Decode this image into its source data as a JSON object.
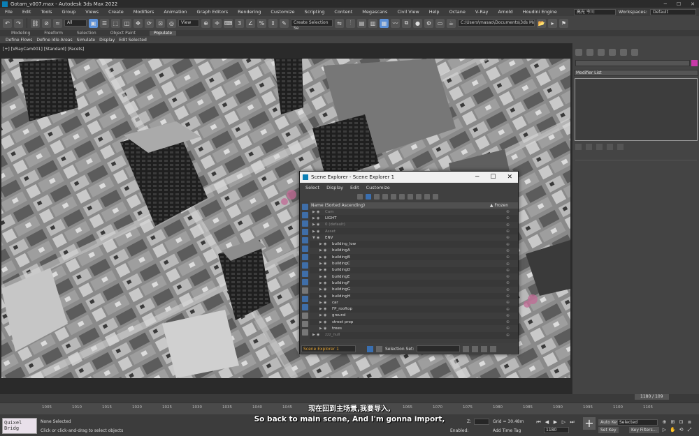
{
  "window": {
    "title": "Gotam_v007.max - Autodesk 3ds Max 2022"
  },
  "menu": [
    "File",
    "Edit",
    "Tools",
    "Group",
    "Views",
    "Create",
    "Modifiers",
    "Animation",
    "Graph Editors",
    "Rendering",
    "Customize",
    "Scripting",
    "Content",
    "Megascans",
    "Civil View",
    "Help",
    "Octane",
    "V-Ray",
    "Arnold",
    "Houdini Engine"
  ],
  "user": {
    "name": "高光 今川",
    "workspaces_label": "Workspaces:",
    "workspace": "Default"
  },
  "toolbar": {
    "filter": "All",
    "view": "View",
    "selection_set": "Create Selection Se",
    "path": "C:\\Users\\masao\\Documents\\3ds Max 2022"
  },
  "ribbon": {
    "tabs": [
      "Modeling",
      "Freeform",
      "Selection",
      "Object Paint",
      "Populate"
    ],
    "active": "Populate",
    "items": [
      "Define Flows",
      "Define Idle Areas",
      "Simulate",
      "Display",
      "Edit Selected"
    ]
  },
  "viewport": {
    "label": "[+] [VRayCam001] [Standard] [Facets]"
  },
  "command_panel": {
    "modifier_list": "Modifier List",
    "accent": "#c83aa8"
  },
  "scene_explorer": {
    "title": "Scene Explorer - Scene Explorer 1",
    "menu": [
      "Select",
      "Display",
      "Edit",
      "Customize"
    ],
    "col_name": "Name (Sorted Ascending)",
    "col_frozen": "▲ Frozen",
    "rows": [
      {
        "label": "Cam",
        "indent": 0,
        "dim": true
      },
      {
        "label": "LIGHT",
        "indent": 0,
        "dim": false
      },
      {
        "label": "0 (default)",
        "indent": 0,
        "dim": true
      },
      {
        "label": "Asset",
        "indent": 0,
        "dim": true
      },
      {
        "label": "ENV",
        "indent": 0,
        "dim": false
      },
      {
        "label": "building_low",
        "indent": 1,
        "dim": false
      },
      {
        "label": "buildingA",
        "indent": 1,
        "dim": false
      },
      {
        "label": "buildingB",
        "indent": 1,
        "dim": false
      },
      {
        "label": "buildingC",
        "indent": 1,
        "dim": false
      },
      {
        "label": "buildingD",
        "indent": 1,
        "dim": false
      },
      {
        "label": "buildingE",
        "indent": 1,
        "dim": false
      },
      {
        "label": "buildingF",
        "indent": 1,
        "dim": false
      },
      {
        "label": "buildingG",
        "indent": 1,
        "dim": false
      },
      {
        "label": "buildingH",
        "indent": 1,
        "dim": false
      },
      {
        "label": "car",
        "indent": 1,
        "dim": false
      },
      {
        "label": "FP_rooftop",
        "indent": 1,
        "dim": false
      },
      {
        "label": "ground",
        "indent": 1,
        "dim": false
      },
      {
        "label": "street prop",
        "indent": 1,
        "dim": false
      },
      {
        "label": "trees",
        "indent": 1,
        "dim": false
      },
      {
        "label": "zzz_null",
        "indent": 0,
        "dim": true
      }
    ],
    "footer_explorer": "Scene Explorer 1",
    "footer_selset": "Selection Set:"
  },
  "timeline": {
    "frame": "1180 / 109",
    "ticks": [
      "1005",
      "1010",
      "1015",
      "1020",
      "1025",
      "1030",
      "1035",
      "1040",
      "1045",
      "1050",
      "1055",
      "1060",
      "1065",
      "1070",
      "1075",
      "1080",
      "1085",
      "1090",
      "1095",
      "1100",
      "1105"
    ]
  },
  "status": {
    "quixel": "Quixel Bridg",
    "selected": "None Selected",
    "hint": "Click or click-and-drag to select objects",
    "grid": "Grid = 30.48m",
    "add_time_tag": "Add Time Tag",
    "enabled": "Enabled:",
    "frame_input": "1180",
    "auto_key": "Auto Key",
    "set_key": "Set Key",
    "selected_dd": "Selected",
    "key_filters": "Key Filters...",
    "z": "Z:"
  },
  "subtitles": {
    "zh": "现在回到主场景,我要导入,",
    "en": "So back to main scene, And I'm gonna import,"
  }
}
